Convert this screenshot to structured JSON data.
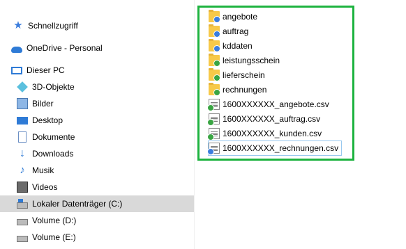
{
  "nav": {
    "items": [
      {
        "label": "Schnellzugriff",
        "icon": "star-icon"
      },
      {
        "label": "OneDrive - Personal",
        "icon": "cloud-icon"
      },
      {
        "label": "Dieser PC",
        "icon": "computer-icon"
      },
      {
        "label": "3D-Objekte",
        "icon": "cube-icon"
      },
      {
        "label": "Bilder",
        "icon": "pictures-icon"
      },
      {
        "label": "Desktop",
        "icon": "desktop-icon"
      },
      {
        "label": "Dokumente",
        "icon": "documents-icon"
      },
      {
        "label": "Downloads",
        "icon": "download-icon"
      },
      {
        "label": "Musik",
        "icon": "music-icon"
      },
      {
        "label": "Videos",
        "icon": "videos-icon"
      },
      {
        "label": "Lokaler Datenträger (C:)",
        "icon": "drive-icon",
        "selected": true
      },
      {
        "label": "Volume (D:)",
        "icon": "drive-icon"
      },
      {
        "label": "Volume (E:)",
        "icon": "drive-icon"
      }
    ]
  },
  "files": {
    "items": [
      {
        "name": "angebote",
        "type": "folder",
        "status": "sync-blue"
      },
      {
        "name": "auftrag",
        "type": "folder",
        "status": "sync-blue"
      },
      {
        "name": "kddaten",
        "type": "folder",
        "status": "sync-blue"
      },
      {
        "name": "leistungsschein",
        "type": "folder",
        "status": "synced-green"
      },
      {
        "name": "lieferschein",
        "type": "folder",
        "status": "synced-green"
      },
      {
        "name": "rechnungen",
        "type": "folder",
        "status": "synced-green"
      },
      {
        "name": "1600XXXXXX_angebote.csv",
        "type": "csv",
        "status": "synced-green"
      },
      {
        "name": "1600XXXXXX_auftrag.csv",
        "type": "csv",
        "status": "synced-green"
      },
      {
        "name": "1600XXXXXX_kunden.csv",
        "type": "csv",
        "status": "synced-green"
      },
      {
        "name": "1600XXXXXX_rechnungen.csv",
        "type": "csv",
        "status": "sync-blue",
        "focused": true
      }
    ]
  },
  "colors": {
    "highlight_border": "#1db33f",
    "selected_nav_bg": "#d9d9d9",
    "accent": "#2f7bd6"
  }
}
